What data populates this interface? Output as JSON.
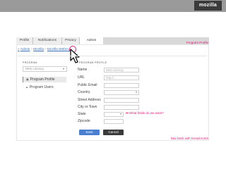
{
  "header": {
    "logo": "mozilla"
  },
  "tabs": [
    "Profile",
    "Notifications",
    "Privacy",
    "Admin"
  ],
  "annotations": {
    "title": "Program Profile",
    "state_question": "What fields do we want?",
    "back_note": "Nav back with breadcrumb"
  },
  "breadcrumb": {
    "back_symbol": "«",
    "parts": [
      "Admin",
      "Mozilla",
      "Mozilla Webm..."
    ],
    "separator": ">"
  },
  "sidebar": {
    "section_label": "PROGRAM",
    "program_select": "Web Literacy",
    "items": [
      {
        "label": "Program Profile",
        "icon": "doc-icon",
        "glyph": "▣"
      },
      {
        "label": "Program Users",
        "icon": "user-icon",
        "glyph": "▲"
      }
    ]
  },
  "form": {
    "section_label": "PROGRAM PROFILE",
    "fields": [
      {
        "label": "Name",
        "value": "Web Literacy",
        "type": "text"
      },
      {
        "label": "URL",
        "value": "http://...",
        "type": "text"
      },
      {
        "label": "Public Email",
        "value": "",
        "type": "text"
      },
      {
        "label": "Country",
        "value": "",
        "type": "select"
      },
      {
        "label": "Street Address",
        "value": "",
        "type": "text"
      },
      {
        "label": "City or Town",
        "value": "",
        "type": "text"
      },
      {
        "label": "State",
        "value": "",
        "type": "select"
      },
      {
        "label": "Zipcode",
        "value": "",
        "type": "text"
      }
    ],
    "save_label": "Save",
    "cancel_label": "Cancel"
  },
  "colors": {
    "accent": "#e0207a",
    "primary_button": "#4a7fd0",
    "secondary_button": "#3b3b3b",
    "header": "#9a9a9a"
  }
}
